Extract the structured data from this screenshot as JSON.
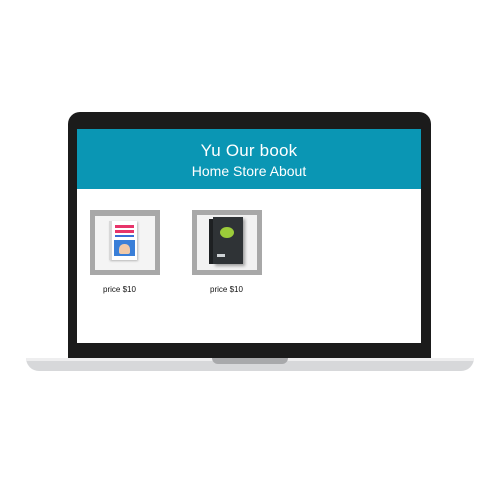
{
  "site": {
    "title": "Yu Our book",
    "nav": [
      {
        "label": "Home"
      },
      {
        "label": "Store"
      },
      {
        "label": "About"
      }
    ]
  },
  "products": [
    {
      "price": "price $10"
    },
    {
      "price": "price $10"
    }
  ],
  "colors": {
    "header_bg": "#0a96b4",
    "thumb_bg": "#a8a8a8",
    "bezel": "#1b1b1b"
  }
}
